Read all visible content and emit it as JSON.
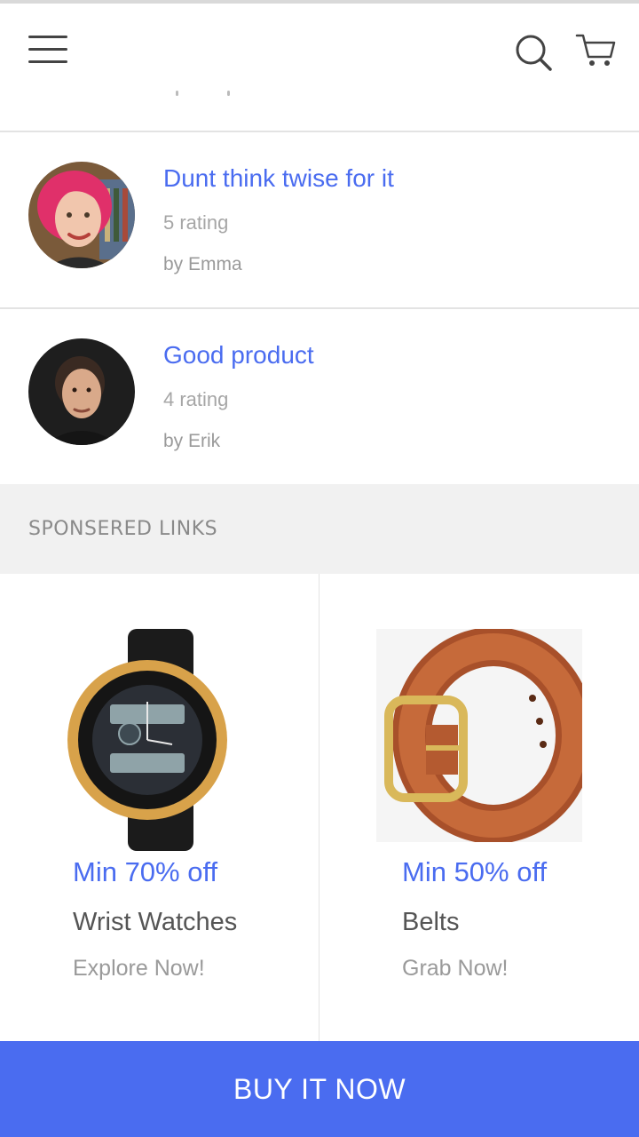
{
  "header": {
    "menu_icon": "hamburger-menu-icon",
    "search_icon": "search-icon",
    "cart_icon": "cart-icon"
  },
  "reviews": [
    {
      "title": "Dunt think twise for it",
      "rating": "5 rating",
      "author": "by Emma",
      "avatar": "avatar-emma"
    },
    {
      "title": "Good product",
      "rating": "4 rating",
      "author": "by Erik",
      "avatar": "avatar-erik"
    }
  ],
  "sponsored": {
    "label": "SPONSERED LINKS",
    "items": [
      {
        "offer": "Min 70% off",
        "name": "Wrist Watches",
        "cta": "Explore Now!",
        "image": "wrist-watch-image"
      },
      {
        "offer": "Min 50% off",
        "name": "Belts",
        "cta": "Grab Now!",
        "image": "belt-image"
      }
    ]
  },
  "buy_button": {
    "label": "BUY IT NOW"
  },
  "colors": {
    "accent": "#4a6cf0",
    "section_bg": "#f1f1f1",
    "muted_text": "#9a9a9a"
  }
}
